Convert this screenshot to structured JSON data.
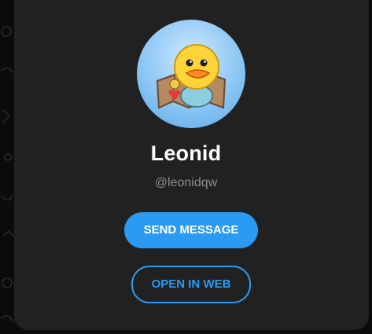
{
  "profile": {
    "name": "Leonid",
    "username": "@leonidqw",
    "avatar_icon": "duck-sticker-avatar"
  },
  "actions": {
    "send_message_label": "SEND MESSAGE",
    "open_in_web_label": "OPEN IN WEB"
  },
  "colors": {
    "accent": "#2b9af3",
    "card_background": "#212121",
    "page_background": "#0b0b0b",
    "username_text": "#8d8d8d"
  }
}
